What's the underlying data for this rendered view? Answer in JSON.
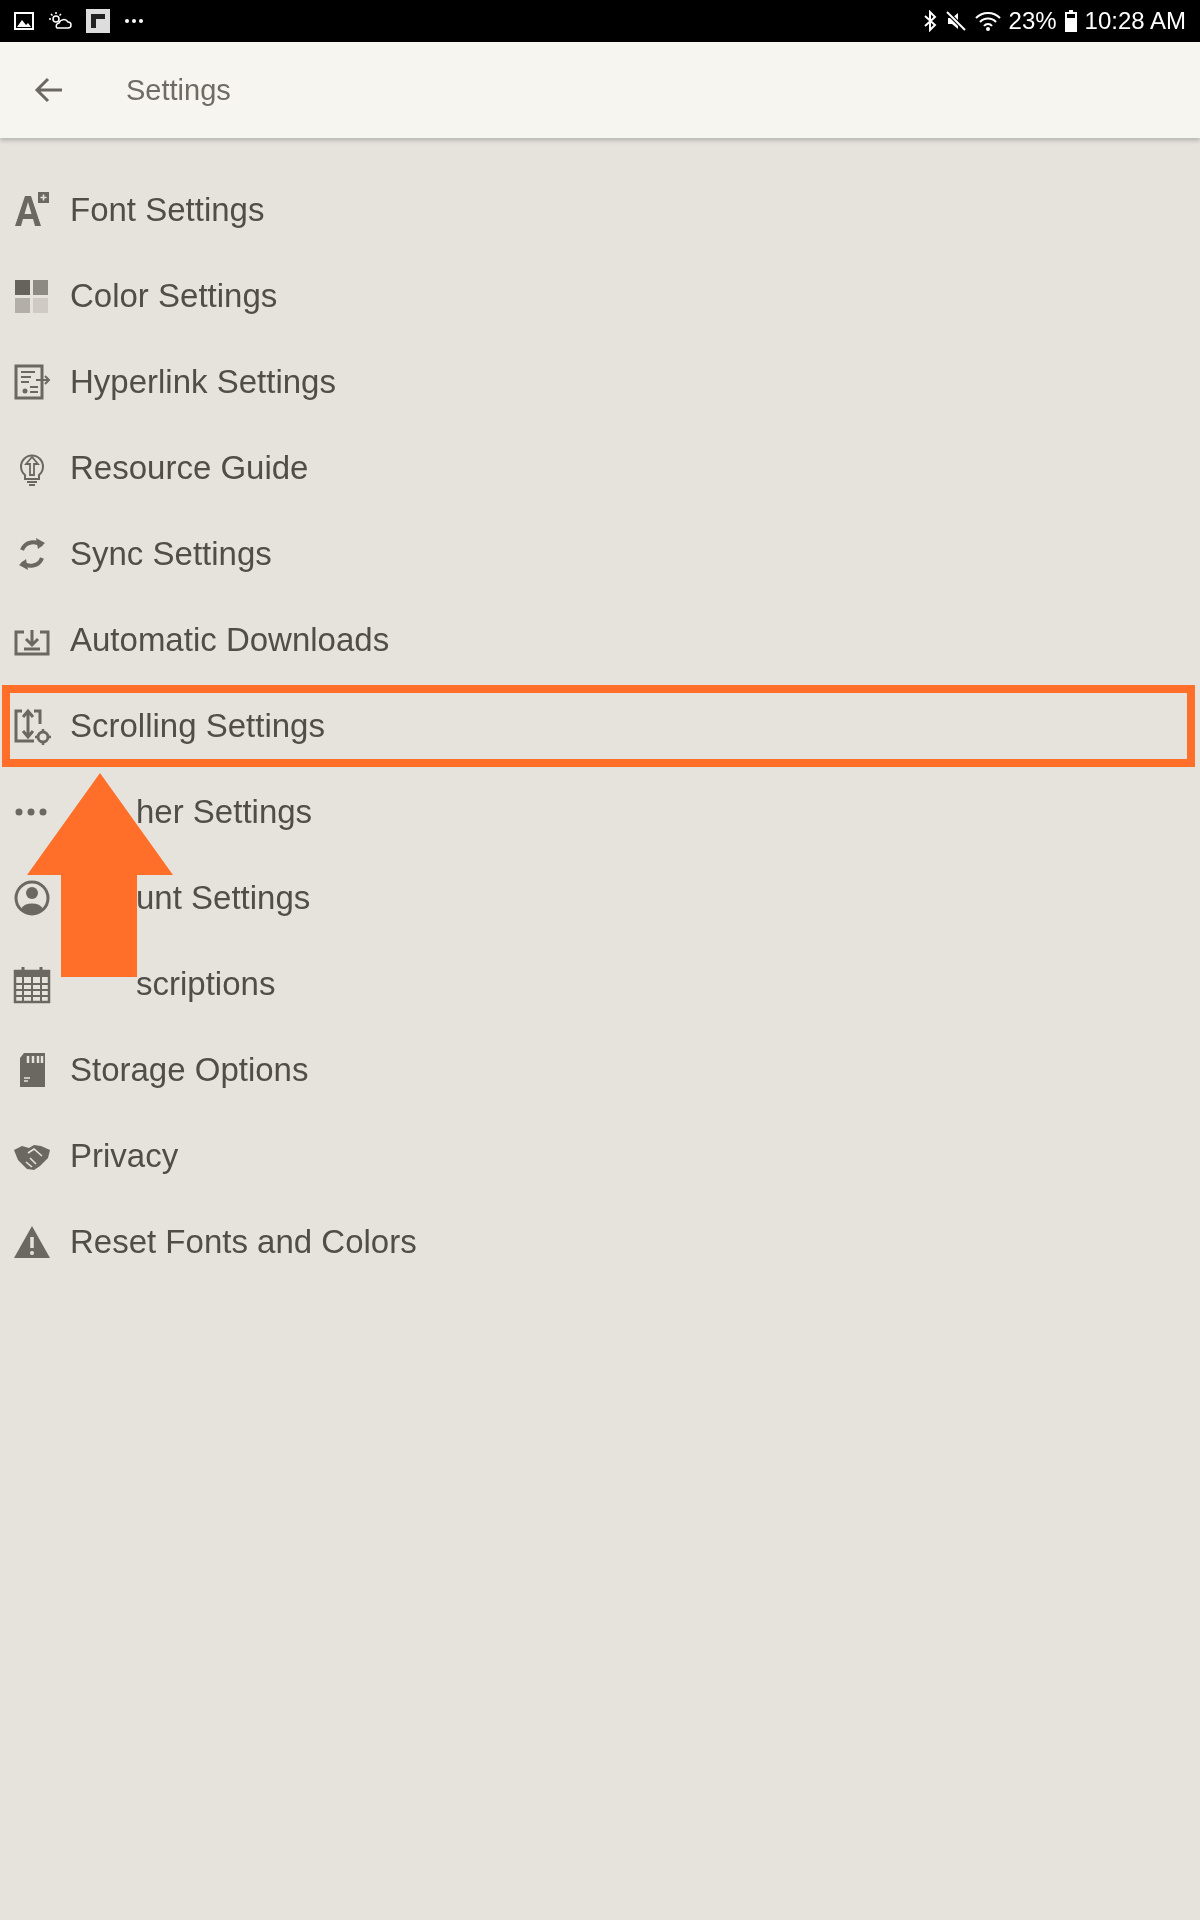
{
  "status_bar": {
    "battery_text": "23%",
    "time": "10:28 AM"
  },
  "app_bar": {
    "title": "Settings"
  },
  "items": [
    {
      "label": "Font Settings",
      "highlighted": false
    },
    {
      "label": "Color Settings",
      "highlighted": false
    },
    {
      "label": "Hyperlink Settings",
      "highlighted": false
    },
    {
      "label": "Resource Guide",
      "highlighted": false
    },
    {
      "label": "Sync Settings",
      "highlighted": false
    },
    {
      "label": "Automatic Downloads",
      "highlighted": false
    },
    {
      "label": "Scrolling Settings",
      "highlighted": true
    },
    {
      "label": "her Settings",
      "highlighted": false,
      "partly_covered": true
    },
    {
      "label": "unt Settings",
      "highlighted": false,
      "partly_covered": true
    },
    {
      "label": "scriptions",
      "highlighted": false,
      "partly_covered": true
    },
    {
      "label": "Storage Options",
      "highlighted": false
    },
    {
      "label": "Privacy",
      "highlighted": false
    },
    {
      "label": "Reset Fonts and Colors",
      "highlighted": false
    }
  ]
}
